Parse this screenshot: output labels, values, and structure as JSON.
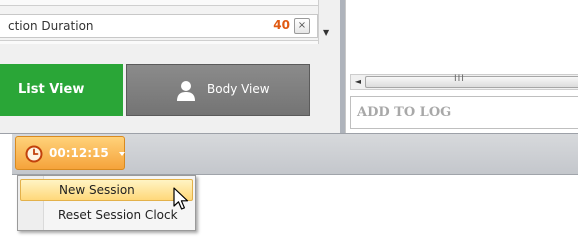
{
  "list": {
    "row_label": "ction Duration",
    "row_count": "40",
    "remove_glyph": "×"
  },
  "scrollbars": {
    "down_arrow": "▼",
    "left_arrow": "◄",
    "grip": "III"
  },
  "views": {
    "list_view_label": "List View",
    "body_view_label": "Body View",
    "body_view_icon": "person-icon"
  },
  "log": {
    "placeholder": "ADD TO LOG"
  },
  "session": {
    "time": "00:12:15",
    "icon": "clock-icon",
    "caret": "dropdown-caret"
  },
  "menu": {
    "items": [
      {
        "label": "New Session"
      },
      {
        "label": "Reset Session Clock"
      }
    ]
  },
  "colors": {
    "accent_green": "#2aa637",
    "accent_orange": "#f5a33b",
    "count_orange": "#e05a12"
  }
}
